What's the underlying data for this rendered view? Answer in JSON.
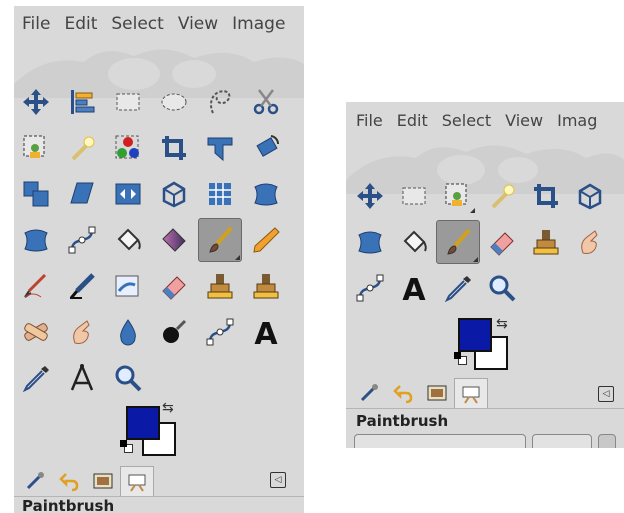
{
  "left": {
    "menu": [
      "File",
      "Edit",
      "Select",
      "View",
      "Image"
    ],
    "active_tool": "Paintbrush"
  },
  "right": {
    "menu": [
      "File",
      "Edit",
      "Select",
      "View",
      "Imag"
    ],
    "active_tool": "Paintbrush"
  },
  "colors": {
    "foreground": "#0a1aa6",
    "background": "#ffffff"
  },
  "icons": {
    "left_tools": [
      "move-icon",
      "align-icon",
      "rect-select-icon",
      "ellipse-select-icon",
      "free-select-icon",
      "scissors-select-icon",
      "foreground-select-icon",
      "fuzzy-select-icon",
      "color-select-icon",
      "crop-icon",
      "unified-transform-icon",
      "rotate-icon",
      "scale-icon",
      "shear-icon",
      "flip-icon",
      "perspective-icon",
      "cage-transform-icon",
      "3d-transform-icon",
      "warp-transform-icon",
      "paths-icon",
      "bucket-fill-icon",
      "gradient-icon",
      "paintbrush-icon",
      "pencil-icon",
      "airbrush-icon",
      "ink-icon",
      "mypaint-brush-icon",
      "eraser-icon",
      "clone-icon",
      "heal-icon",
      "heal-bandage-icon",
      "smudge-icon",
      "blur-icon",
      "dodge-burn-icon",
      "paths-tool-icon",
      "text-icon",
      "color-picker-icon",
      "measure-icon",
      "zoom-icon"
    ],
    "right_tools": [
      "move-icon",
      "rect-select-icon",
      "foreground-select-icon",
      "fuzzy-select-icon",
      "crop-icon",
      "3d-transform-icon",
      "warp-transform-icon",
      "bucket-fill-icon",
      "paintbrush-icon",
      "eraser-icon",
      "clone-icon",
      "smudge-icon",
      "paths-tool-icon",
      "text-icon",
      "color-picker-icon",
      "zoom-icon"
    ],
    "tabs": [
      "tool-options-icon",
      "undo-history-icon",
      "images-icon",
      "device-status-icon"
    ]
  }
}
